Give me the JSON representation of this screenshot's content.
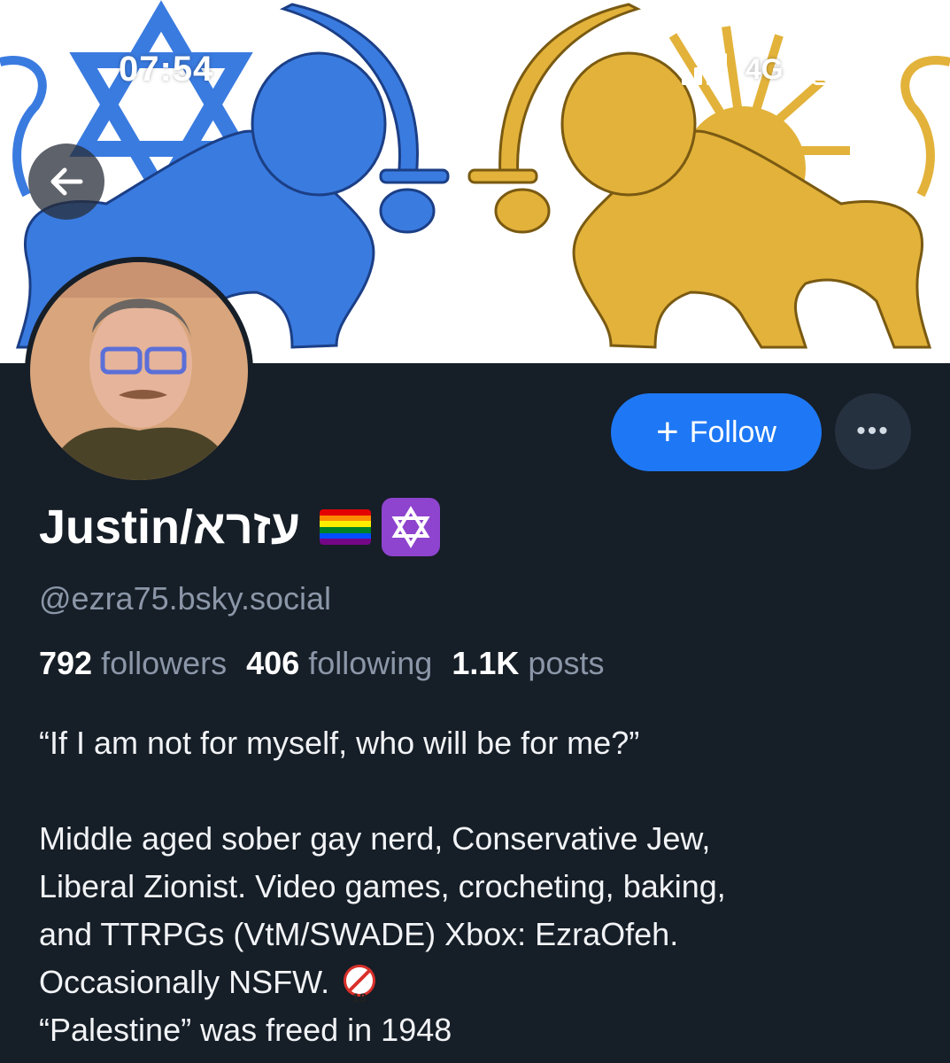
{
  "status_bar": {
    "time": "07:54",
    "network": "4G"
  },
  "profile": {
    "display_name": "Justin/עזרא",
    "handle": "@ezra75.bsky.social",
    "follow_label": "Follow",
    "more_label": "•••",
    "stats": {
      "followers_count": "792",
      "followers_label": "followers",
      "following_count": "406",
      "following_label": "following",
      "posts_count": "1.1K",
      "posts_label": "posts"
    },
    "bio": {
      "line1": "“If I am not for myself, who will be for me?”",
      "line2": "Middle aged sober gay nerd, Conservative Jew,",
      "line3": "Liberal Zionist. Video games, crocheting, baking,",
      "line4": "and TTRPGs (VtM/SWADE) Xbox: EzraOfeh.",
      "line5": "Occasionally NSFW.",
      "line6": "“Palestine” was freed in 1948"
    },
    "nsfw_badge_text": "18"
  },
  "icons": {
    "back": "arrow-left-icon",
    "rainbow_flag": "rainbow-flag-icon",
    "star_of_david": "star-of-david-icon",
    "no_under_18": "no-under-18-icon"
  },
  "colors": {
    "background": "#161e27",
    "accent": "#1e78f5",
    "banner_blue_lion": "#3a7be0",
    "banner_gold_lion": "#e2b23a"
  }
}
